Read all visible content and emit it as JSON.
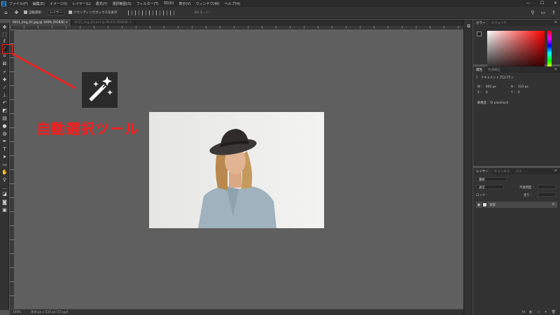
{
  "menubar": {
    "logo": "Ps",
    "items": [
      "ファイル(F)",
      "編集(E)",
      "イメージ(I)",
      "レイヤー(L)",
      "書式(Y)",
      "選択範囲(S)",
      "フィルター(T)",
      "3D(D)",
      "表示(V)",
      "ウィンドウ(W)",
      "ヘルプ(H)"
    ],
    "window_controls": [
      "—",
      "☐",
      "✕"
    ]
  },
  "options_bar": {
    "auto_select_label": "自動選択 :",
    "auto_select_target": "レイヤー",
    "bounding_box_label": "バウンディングボックスを表示",
    "mode_3d_label": "3D モード :"
  },
  "tabs": [
    {
      "label": "0011_img_01.jpg @ 100% (RGB/8) ×"
    },
    {
      "label": "0011_img_02.psd @ 66.4% (RGB/8) ×"
    }
  ],
  "status": {
    "zoom": "100%",
    "doc_info": "800 px x 533 px (72 ppi)"
  },
  "color_panel": {
    "tabs": [
      "カラー",
      "スウォッチ"
    ]
  },
  "properties_panel": {
    "tabs": [
      "属性",
      "色調補正"
    ],
    "section": "ドキュメントプロパティ",
    "w_label": "W :",
    "w_value": "800 px",
    "h_label": "H :",
    "h_value": "533 px",
    "x_label": "X :",
    "x_value": "0",
    "y_label": "Y :",
    "y_value": "0",
    "resolution": "解像度 : 72 pixel/inch"
  },
  "layers_panel": {
    "tabs": [
      "レイヤー",
      "チャンネル",
      "パス"
    ],
    "search_placeholder": "種類",
    "blend_mode": "通常",
    "opacity_label": "不透明度 :",
    "lock_label": "ロック :",
    "fill_label": "塗り :",
    "layer_name": "背景",
    "footer_icons": [
      "fx",
      "◐",
      "▭",
      "+",
      "🗑"
    ]
  },
  "annotation": {
    "label": "自動選択ツール",
    "color": "#ff1a1a"
  }
}
